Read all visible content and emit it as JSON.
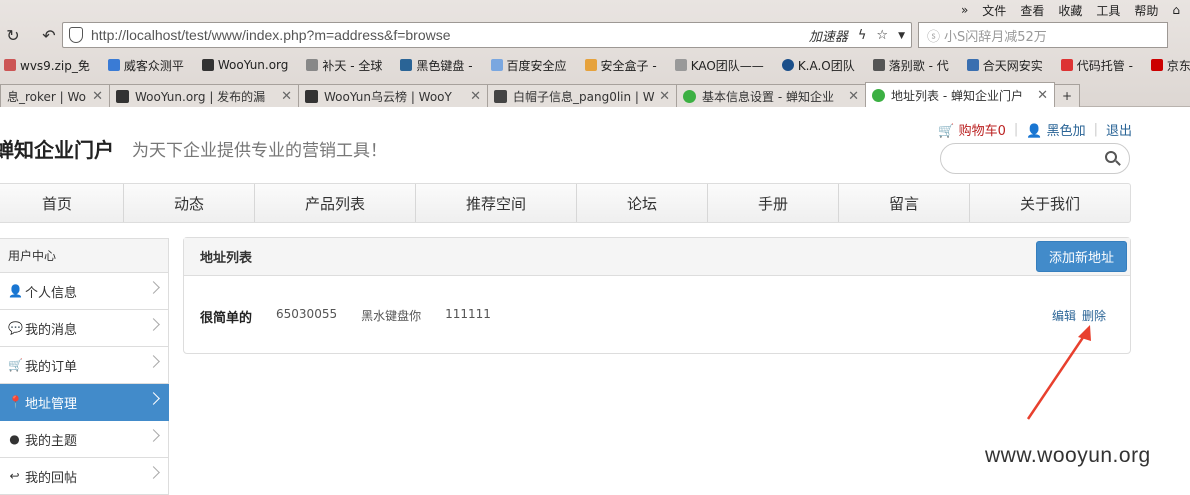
{
  "browser": {
    "menu": [
      "文件",
      "查看",
      "收藏",
      "工具",
      "帮助"
    ],
    "url": "http://localhost/test/www/index.php?m=address&f=browse",
    "accelerator_label": "加速器",
    "search_placeholder": "小S闪辞月减52万",
    "bookmarks": [
      "wvs9.zip_免",
      "威客众测平",
      "WooYun.org",
      "补天 - 全球",
      "黑色键盘 -",
      "百度安全应",
      "安全盒子 -",
      "KAO团队——",
      "K.A.O团队",
      "落别歌 - 代",
      "合天网安实",
      "代码托管 -",
      "京东商"
    ],
    "tabs": [
      {
        "label": "息_roker | Wo"
      },
      {
        "label": "WooYun.org | 发布的漏"
      },
      {
        "label": "WooYun乌云榜 | WooY"
      },
      {
        "label": "白帽子信息_pang0lin | W"
      },
      {
        "label": "基本信息设置 - 蝉知企业"
      },
      {
        "label": "地址列表 - 蝉知企业门户"
      }
    ],
    "new_tab_label": "+"
  },
  "site": {
    "brand": "蝉知企业门户",
    "slogan": "为天下企业提供专业的营销工具！",
    "cart_label": "购物车0",
    "user_label": "黑色加",
    "logout_label": "退出",
    "nav": [
      "首页",
      "动态",
      "产品列表",
      "推荐空间",
      "论坛",
      "手册",
      "留言",
      "关于我们"
    ]
  },
  "sidebar": {
    "title": "用户中心",
    "items": [
      {
        "label": "个人信息",
        "icon": "user-icon"
      },
      {
        "label": "我的消息",
        "icon": "comments-icon"
      },
      {
        "label": "我的订单",
        "icon": "cart-icon"
      },
      {
        "label": "地址管理",
        "icon": "map-marker-icon",
        "active": true
      },
      {
        "label": "我的主题",
        "icon": "comment-icon"
      },
      {
        "label": "我的回帖",
        "icon": "reply-icon"
      }
    ]
  },
  "panel": {
    "title": "地址列表",
    "add_button": "添加新地址",
    "address": {
      "name": "很简单的",
      "phone": "65030055",
      "address": "黑水键盘你",
      "zipcode": "111111",
      "edit": "编辑",
      "delete": "删除"
    }
  },
  "watermark": "www.wooyun.org",
  "colors": {
    "primary": "#428bca",
    "annotation_arrow": "#e8402e"
  }
}
